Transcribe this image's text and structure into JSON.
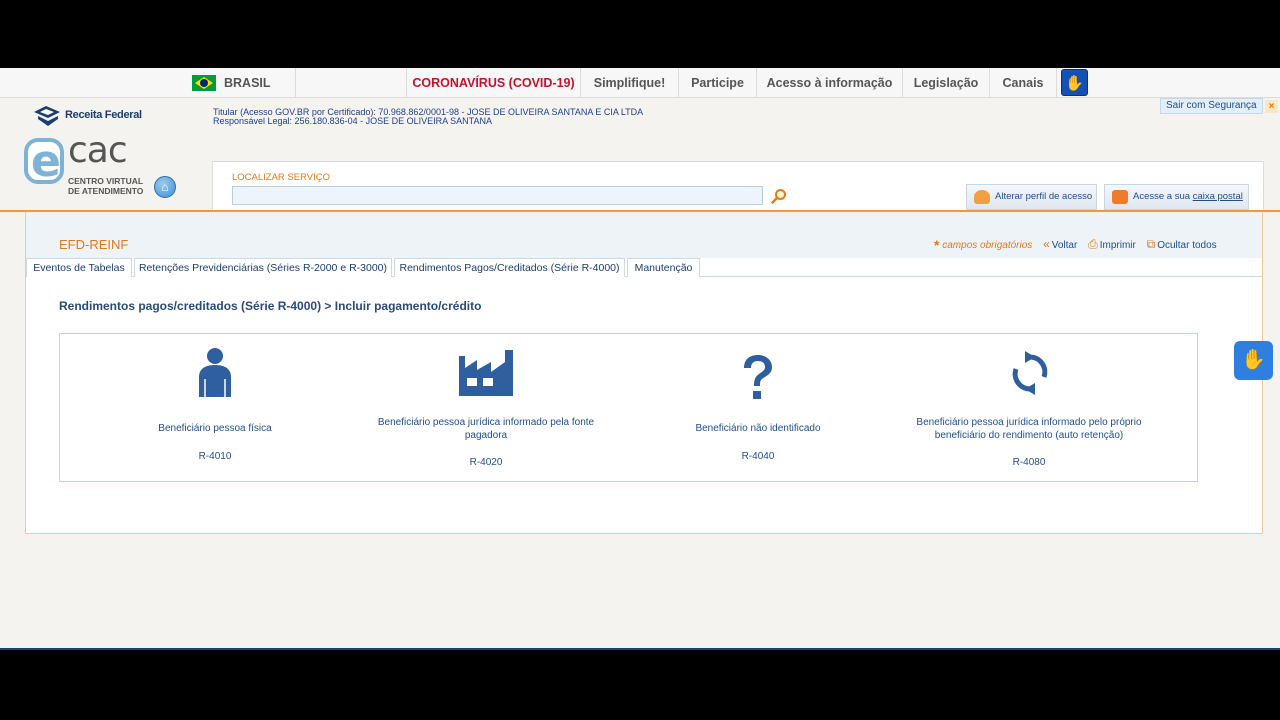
{
  "govbar": {
    "brasil": "BRASIL",
    "covid": "CORONAVÍRUS (COVID-19)",
    "simplifique": "Simplifique!",
    "participe": "Participe",
    "acesso": "Acesso à informação",
    "legislacao": "Legislação",
    "canais": "Canais"
  },
  "header": {
    "rf_logo_text": "Receita Federal",
    "ecac_cac": "cac",
    "ecac_sub1": "CENTRO VIRTUAL",
    "ecac_sub2": "DE ATENDIMENTO",
    "titular": "Titular (Acesso GOV.BR por Certificado): 70.968.862/0001-98 - JOSE DE OLIVEIRA SANTANA E CIA LTDA",
    "responsavel": "Responsável Legal: 256.180.836-04 - JOSE DE OLIVEIRA SANTANA",
    "sair": "Sair com Segurança",
    "sair_close": "×",
    "search_label": "LOCALIZAR SERVIÇO",
    "search_value": "",
    "btn_perfil": "Alterar perfil de acesso",
    "btn_caixa_prefix": "Acesse a sua ",
    "btn_caixa_link": "caixa postal"
  },
  "content": {
    "title": "EFD-REINF",
    "required": "campos obrigatórios",
    "voltar": "Voltar",
    "imprimir": "Imprimir",
    "ocultar": "Ocultar todos",
    "tabs": [
      "Eventos de Tabelas",
      "Retenções Previdenciárias (Séries R-2000 e R-3000)",
      "Rendimentos Pagos/Creditados (Série R-4000)",
      "Manutenção"
    ],
    "breadcrumb": "Rendimentos pagos/creditados (Série R-4000) > Incluir pagamento/crédito",
    "options": [
      {
        "label": "Beneficiário pessoa física",
        "code": "R-4010",
        "icon": "person-icon"
      },
      {
        "label": "Beneficiário pessoa jurídica informado pela fonte pagadora",
        "code": "R-4020",
        "icon": "factory-icon"
      },
      {
        "label": "Beneficiário não identificado",
        "code": "R-4040",
        "icon": "question-icon"
      },
      {
        "label": "Beneficiário pessoa jurídica informado pelo próprio beneficiário do rendimento (auto retenção)",
        "code": "R-4080",
        "icon": "refresh-icon"
      }
    ]
  },
  "colors": {
    "accent_orange": "#e07a1f",
    "link_blue": "#1f4e8c",
    "icon_blue": "#2f5f9e",
    "covid_red": "#c8102e"
  }
}
